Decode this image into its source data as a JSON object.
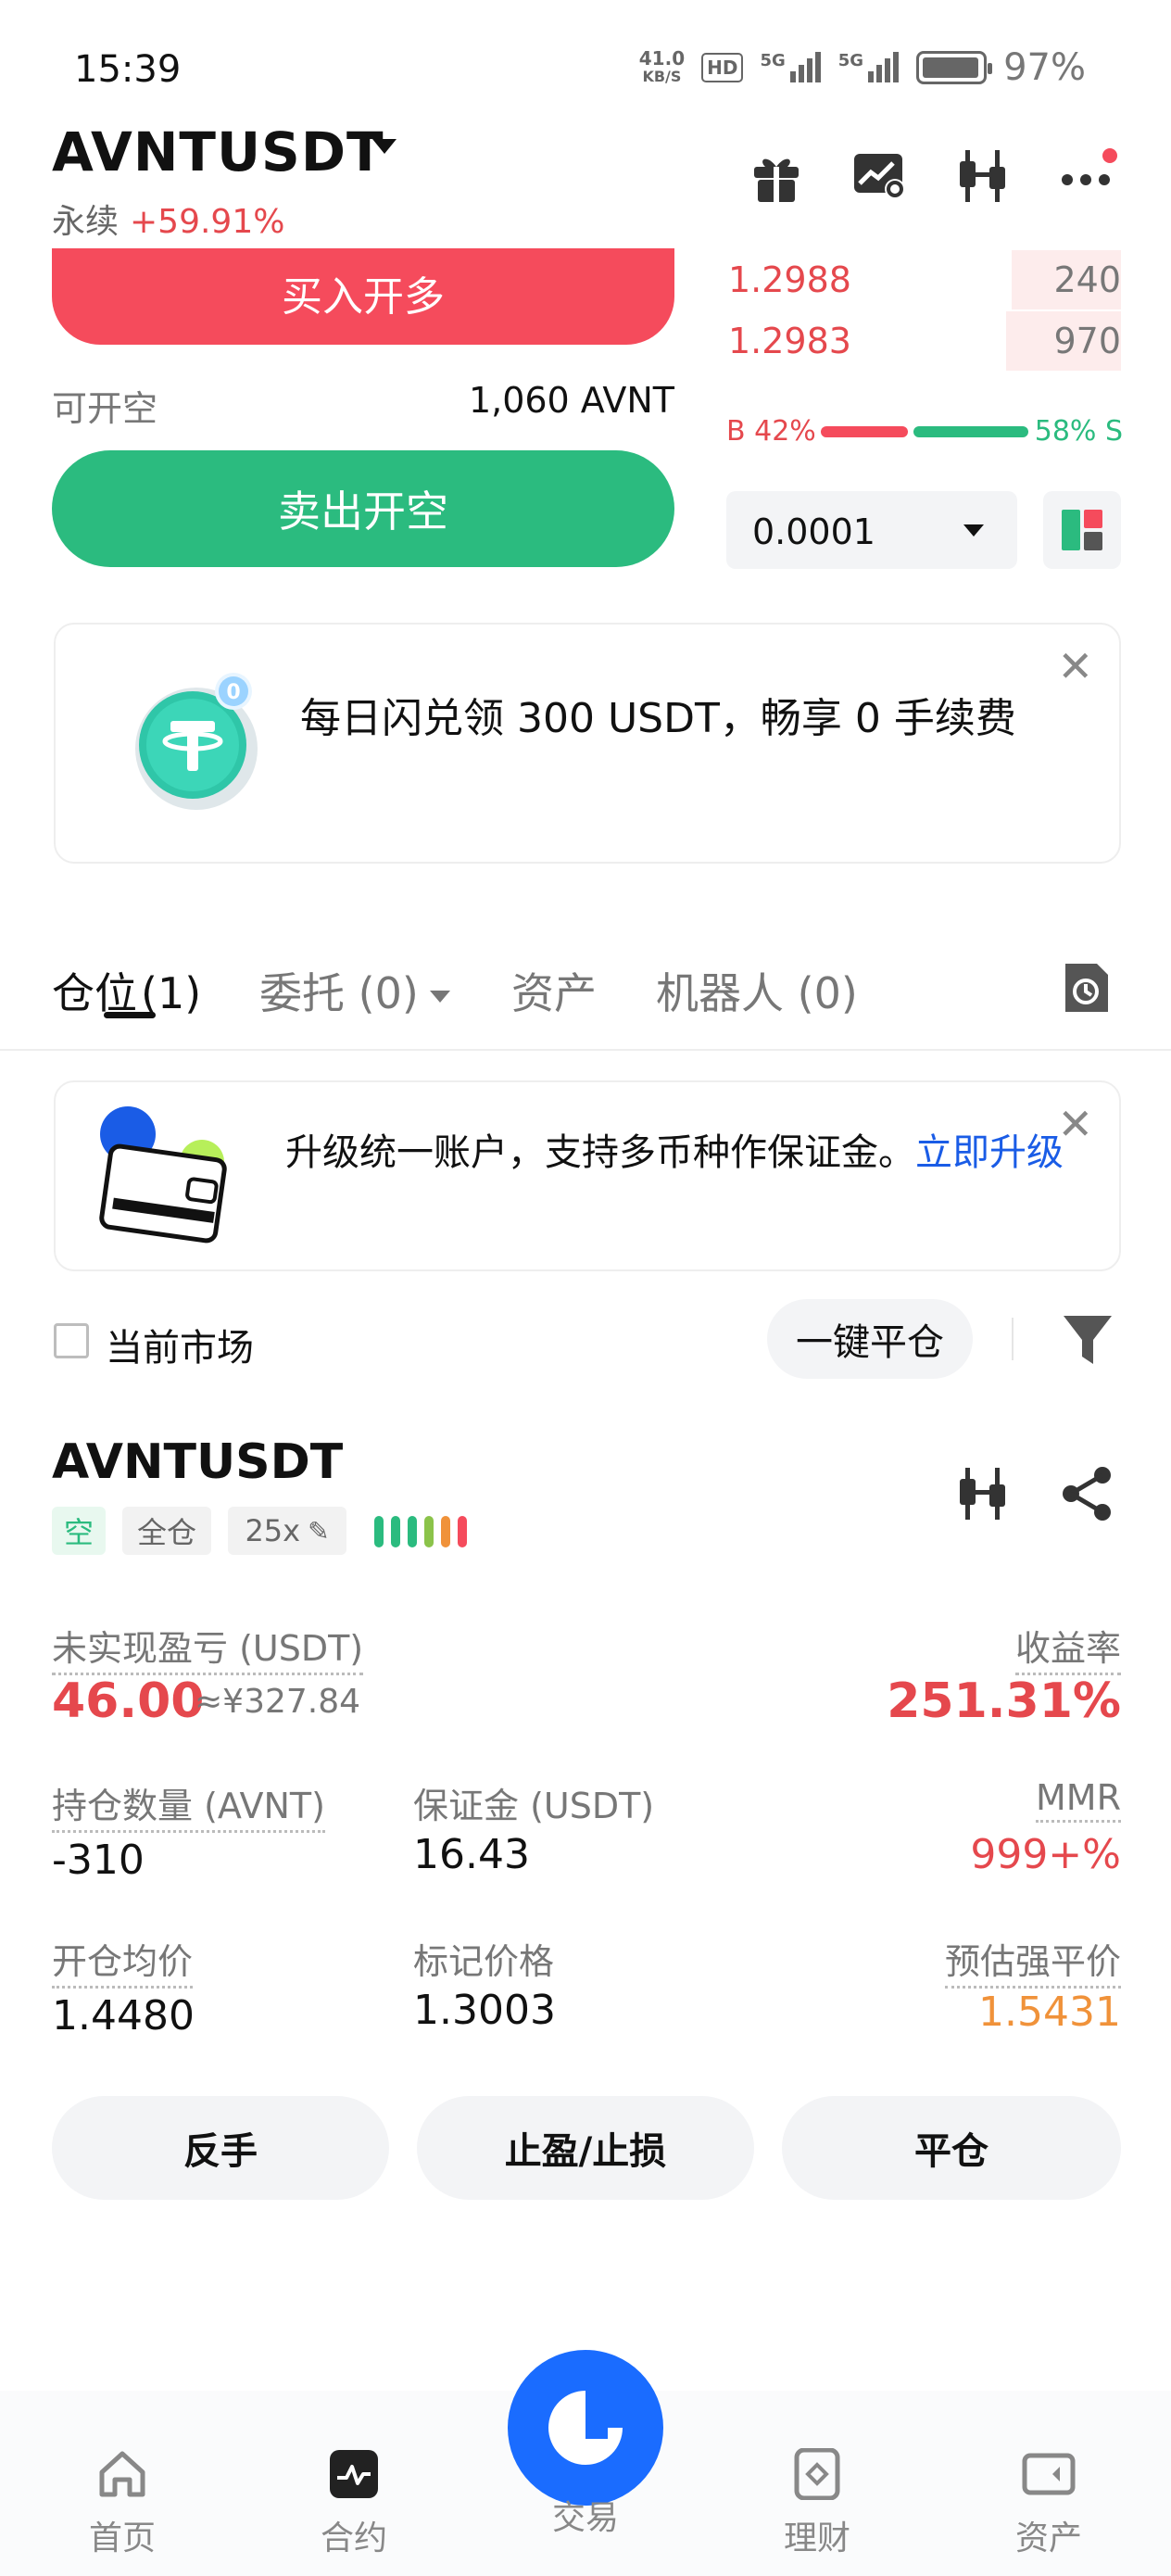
{
  "status_bar": {
    "time": "15:39",
    "net_speed_value": "41.0",
    "net_speed_unit": "KB/S",
    "hd": "HD",
    "sig1": "5G",
    "sig2": "5G",
    "battery": "97%"
  },
  "header": {
    "symbol": "AVNTUSDT",
    "contract_type": "永续",
    "change": "+59.91%",
    "icons": [
      "gift-icon",
      "chart-settings-icon",
      "candlestick-icon",
      "more-icon"
    ]
  },
  "trade": {
    "buy_label": "买入开多",
    "open_short_label": "可开空",
    "open_short_value": "1,060 AVNT",
    "sell_label": "卖出开空"
  },
  "order_book": {
    "asks": [
      {
        "price": "1.2988",
        "qty": "240"
      },
      {
        "price": "1.2983",
        "qty": "970"
      }
    ],
    "buy_ratio": "B 42%",
    "sell_ratio": "58% S",
    "buy_pct": 42,
    "step": "0.0001"
  },
  "promo": {
    "text": "每日闪兑领 300 USDT，畅享 0 手续费",
    "badge": "0"
  },
  "tabs": [
    {
      "label": "仓位",
      "count": "(1)"
    },
    {
      "label": "委托 (0)"
    },
    {
      "label": "资产"
    },
    {
      "label": "机器人 (0)"
    }
  ],
  "upgrade": {
    "text": "升级统一账户，支持多币种作保证金。",
    "link": "立即升级"
  },
  "filter": {
    "current_market": "当前市场",
    "close_all": "一键平仓"
  },
  "position": {
    "symbol": "AVNTUSDT",
    "side": "空",
    "margin_mode": "全仓",
    "leverage": "25x",
    "upnl_label": "未实现盈亏 (USDT)",
    "upnl_value": "46.00",
    "upnl_cny": "≈¥327.84",
    "roe_label": "收益率",
    "roe_value": "251.31%",
    "size_label": "持仓数量 (AVNT)",
    "size_value": "-310",
    "margin_label": "保证金 (USDT)",
    "margin_value": "16.43",
    "mmr_label": "MMR",
    "mmr_value": "999+%",
    "entry_label": "开仓均价",
    "entry_value": "1.4480",
    "mark_label": "标记价格",
    "mark_value": "1.3003",
    "liq_label": "预估强平价",
    "liq_value": "1.5431",
    "btn_reverse": "反手",
    "btn_tpsl": "止盈/止损",
    "btn_close": "平仓"
  },
  "nav": [
    {
      "label": "首页",
      "icon": "home-icon"
    },
    {
      "label": "合约",
      "icon": "futures-icon"
    },
    {
      "label": "交易",
      "icon": "trade-icon"
    },
    {
      "label": "理财",
      "icon": "earn-icon"
    },
    {
      "label": "资产",
      "icon": "wallet-icon"
    }
  ],
  "colors": {
    "buy": "#f54b5c",
    "sell": "#2bbb7f",
    "link": "#1a5ce6",
    "fab": "#1a6cff"
  }
}
